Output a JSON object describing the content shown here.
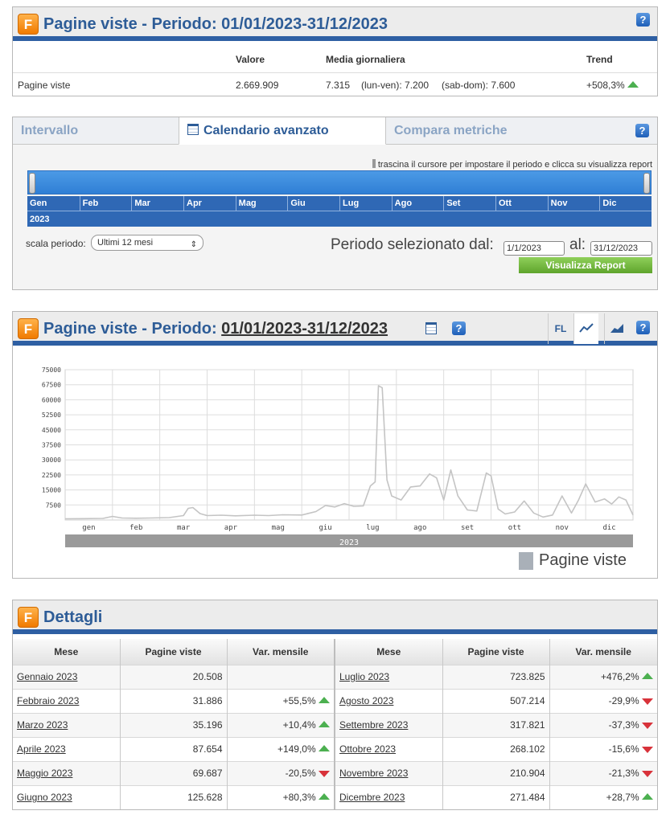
{
  "summary": {
    "title": "Pagine viste - Periodo: 01/01/2023-31/12/2023",
    "headers": {
      "valore": "Valore",
      "media": "Media giornaliera",
      "trend": "Trend"
    },
    "row": {
      "label": "Pagine viste",
      "valore": "2.669.909",
      "media": "7.315",
      "lun_ven": "(lun-ven): 7.200",
      "sab_dom": "(sab-dom): 7.600",
      "trend": "+508,3%"
    }
  },
  "tabs": {
    "items": [
      "Intervallo",
      "Calendario avanzato",
      "Compara metriche"
    ],
    "active": "Calendario avanzato",
    "hint": "trascina il cursore per impostare il periodo e clicca su visualizza report",
    "months": [
      "Gen",
      "Feb",
      "Mar",
      "Apr",
      "Mag",
      "Giu",
      "Lug",
      "Ago",
      "Set",
      "Ott",
      "Nov",
      "Dic"
    ],
    "year": "2023",
    "scala_label": "scala periodo:",
    "scala_value": "Ultimi 12 mesi",
    "periodo_label": "Periodo selezionato dal:",
    "al_label": "al:",
    "from": "1/1/2023",
    "to": "31/12/2023",
    "button": "Visualizza Report"
  },
  "chart_panel": {
    "title_prefix": "Pagine viste - Periodo: ",
    "title_period": "01/01/2023-31/12/2023",
    "fl_label": "FL",
    "icons": [
      "calendar-icon",
      "help-icon",
      "line-chart-icon",
      "area-chart-icon"
    ]
  },
  "chart_data": {
    "type": "line",
    "ylim": [
      0,
      75000
    ],
    "yticks": [
      7500,
      15000,
      22500,
      30000,
      37500,
      45000,
      52500,
      60000,
      67500,
      75000
    ],
    "month_labels": [
      "gen",
      "feb",
      "mar",
      "apr",
      "mag",
      "giu",
      "lug",
      "ago",
      "set",
      "ott",
      "nov",
      "dic"
    ],
    "year_label": "2023",
    "series": [
      {
        "name": "Pagine viste",
        "color": "#c4c4c4",
        "x_month": [
          0.0,
          0.4,
          0.8,
          1.0,
          1.2,
          1.5,
          1.8,
          2.2,
          2.5,
          2.6,
          2.7,
          2.85,
          3.0,
          3.3,
          3.6,
          4.0,
          4.3,
          4.6,
          5.0,
          5.3,
          5.5,
          5.7,
          5.9,
          6.1,
          6.3,
          6.45,
          6.55,
          6.62,
          6.7,
          6.8,
          6.9,
          7.1,
          7.3,
          7.5,
          7.7,
          7.85,
          8.0,
          8.15,
          8.3,
          8.5,
          8.7,
          8.9,
          9.0,
          9.15,
          9.3,
          9.5,
          9.7,
          9.9,
          10.1,
          10.3,
          10.5,
          10.7,
          10.85,
          11.0,
          11.2,
          11.4,
          11.55,
          11.7,
          11.85,
          12.0
        ],
        "values": [
          600,
          700,
          800,
          1800,
          1000,
          900,
          1000,
          1200,
          2200,
          5800,
          6200,
          3200,
          2200,
          2400,
          2100,
          2400,
          2200,
          2600,
          2500,
          4200,
          7200,
          6500,
          8200,
          6800,
          7000,
          17000,
          19000,
          67000,
          66000,
          20000,
          12000,
          10000,
          16500,
          17000,
          23000,
          21000,
          10000,
          25000,
          12000,
          5000,
          4500,
          23500,
          22000,
          5500,
          3000,
          4000,
          9500,
          3500,
          1500,
          2500,
          12000,
          3500,
          10000,
          18000,
          9000,
          10500,
          8000,
          11500,
          10000,
          2500
        ]
      }
    ]
  },
  "details": {
    "title": "Dettagli",
    "headers": [
      "Mese",
      "Pagine viste",
      "Var. mensile",
      "Mese",
      "Pagine viste",
      "Var. mensile"
    ],
    "left": [
      {
        "mese": "Gennaio 2023",
        "pv": "20.508",
        "var": "",
        "dir": ""
      },
      {
        "mese": "Febbraio 2023",
        "pv": "31.886",
        "var": "+55,5%",
        "dir": "up"
      },
      {
        "mese": "Marzo 2023",
        "pv": "35.196",
        "var": "+10,4%",
        "dir": "up"
      },
      {
        "mese": "Aprile 2023",
        "pv": "87.654",
        "var": "+149,0%",
        "dir": "up"
      },
      {
        "mese": "Maggio 2023",
        "pv": "69.687",
        "var": "-20,5%",
        "dir": "down"
      },
      {
        "mese": "Giugno 2023",
        "pv": "125.628",
        "var": "+80,3%",
        "dir": "up"
      }
    ],
    "right": [
      {
        "mese": "Luglio 2023",
        "pv": "723.825",
        "var": "+476,2%",
        "dir": "up"
      },
      {
        "mese": "Agosto 2023",
        "pv": "507.214",
        "var": "-29,9%",
        "dir": "down"
      },
      {
        "mese": "Settembre 2023",
        "pv": "317.821",
        "var": "-37,3%",
        "dir": "down"
      },
      {
        "mese": "Ottobre 2023",
        "pv": "268.102",
        "var": "-15,6%",
        "dir": "down"
      },
      {
        "mese": "Novembre 2023",
        "pv": "210.904",
        "var": "-21,3%",
        "dir": "down"
      },
      {
        "mese": "Dicembre 2023",
        "pv": "271.484",
        "var": "+28,7%",
        "dir": "up"
      }
    ]
  }
}
